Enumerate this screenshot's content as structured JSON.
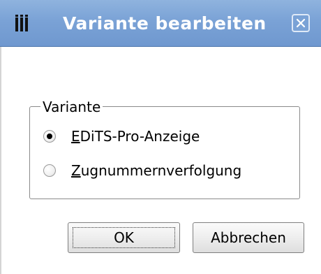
{
  "window": {
    "title": "Variante bearbeiten",
    "close_label": "Close",
    "accent_color": "#7aa2d6"
  },
  "group": {
    "label": "Variante",
    "options": [
      {
        "mnemonic": "E",
        "rest": "DiTS-Pro-Anzeige",
        "selected": true
      },
      {
        "mnemonic": "Z",
        "rest": "ugnummernverfolgung",
        "selected": false
      }
    ]
  },
  "buttons": {
    "ok_label": "OK",
    "cancel_label": "Abbrechen"
  },
  "icons": {
    "app": "bars-app-icon",
    "close": "close-icon"
  }
}
